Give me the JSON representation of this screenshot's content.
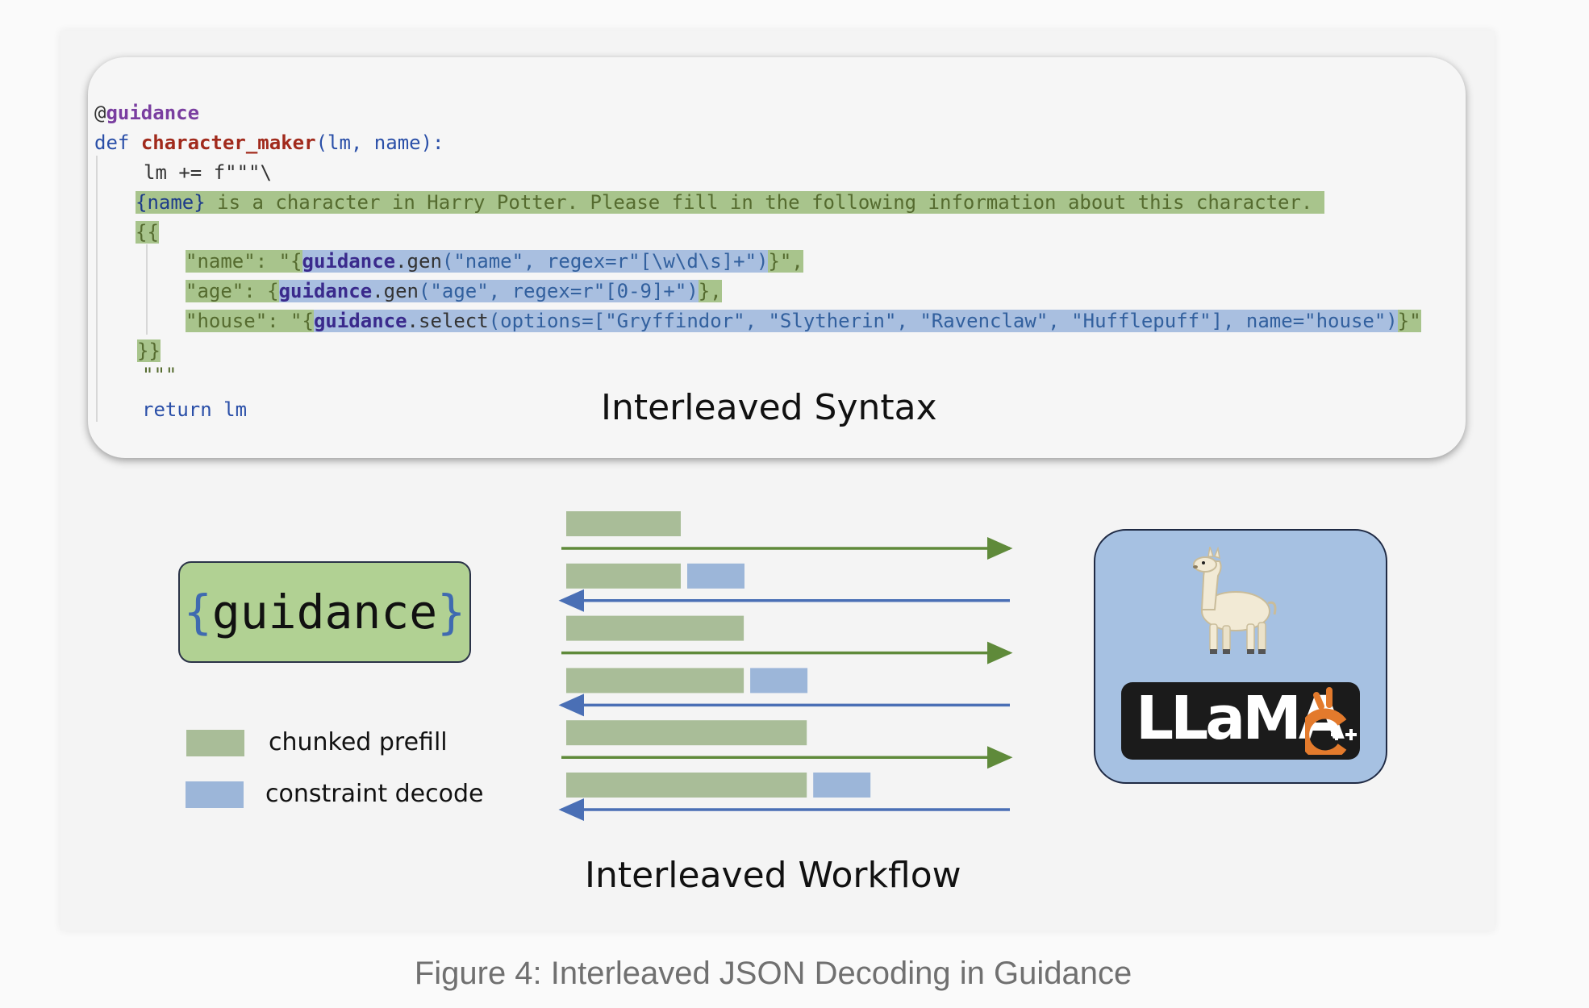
{
  "code": {
    "decorator_at": "@",
    "decorator_name": "guidance",
    "def_kw": "def",
    "func_name": "character_maker",
    "params": "(lm, name):",
    "line_lm": "lm += f\"\"\"\\",
    "prompt_var": "{name}",
    "prompt_text": " is a character in Harry Potter. Please fill in the following information about this character.",
    "open_braces": "{{",
    "name_key": "\"name\": \"{",
    "name_call_obj": "guidance",
    "name_call_fn": ".gen",
    "name_call_args": "(\"name\", regex=r\"[\\w\\d\\s]+\")",
    "name_tail": "}\",",
    "age_key": "\"age\": {",
    "age_call_obj": "guidance",
    "age_call_fn": ".gen",
    "age_call_args": "(\"age\", regex=r\"[0-9]+\")",
    "age_tail": "},",
    "house_key": "\"house\": \"{",
    "house_call_obj": "guidance",
    "house_call_fn": ".select",
    "house_call_args": "(options=[\"Gryffindor\", \"Slytherin\", \"Ravenclaw\", \"Hufflepuff\"], name=\"house\")",
    "house_tail": "}\"",
    "close_braces": "}}",
    "triple_quote": "\"\"\"",
    "return_kw": "return",
    "return_val": " lm"
  },
  "titles": {
    "syntax": "Interleaved Syntax",
    "workflow": "Interleaved Workflow"
  },
  "guidance_logo": {
    "open": "{",
    "word": "guidance",
    "close": "}"
  },
  "legend": {
    "prefill": "chunked prefill",
    "decode": "constraint decode"
  },
  "colors": {
    "prefill": "#a9bd98",
    "decode": "#9cb6d9",
    "arrow_forward": "#5f8a3a",
    "arrow_back": "#4a6fb5"
  },
  "workflow_rows": [
    {
      "prefill": 1.0,
      "decode": 0,
      "arrow": "forward"
    },
    {
      "prefill": 1.0,
      "decode": 0.5,
      "arrow": "back"
    },
    {
      "prefill": 1.55,
      "decode": 0,
      "arrow": "forward"
    },
    {
      "prefill": 1.55,
      "decode": 0.5,
      "arrow": "back"
    },
    {
      "prefill": 2.1,
      "decode": 0,
      "arrow": "forward"
    },
    {
      "prefill": 2.1,
      "decode": 0.5,
      "arrow": "back"
    }
  ],
  "llama_logo": {
    "word": "LLaMA",
    "mascot": "llama-icon",
    "cpp_mark": "c-plus-plus-icon"
  },
  "caption": "Figure 4: Interleaved JSON Decoding in Guidance"
}
